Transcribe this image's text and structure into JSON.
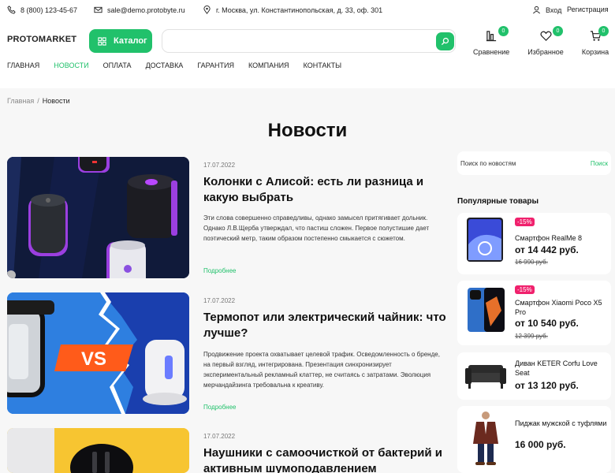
{
  "topbar": {
    "phone": "8 (800) 123-45-67",
    "email": "sale@demo.protobyte.ru",
    "address": "г. Москва, ул. Константинопольская, д. 33, оф. 301",
    "login": "Вход",
    "register": "Регистрация"
  },
  "header": {
    "logo": "PROTOMARKET",
    "catalog": "Каталог",
    "search_placeholder": "",
    "compare": {
      "label": "Сравнение",
      "count": "0"
    },
    "favorites": {
      "label": "Избранное",
      "count": "0"
    },
    "cart": {
      "label": "Корзина",
      "count": "0"
    }
  },
  "nav": [
    "ГЛАВНАЯ",
    "НОВОСТИ",
    "ОПЛАТА",
    "ДОСТАВКА",
    "ГАРАНТИЯ",
    "КОМПАНИЯ",
    "КОНТАКТЫ"
  ],
  "breadcrumb": {
    "home": "Главная",
    "sep": "/",
    "current": "Новости"
  },
  "page_title": "Новости",
  "news": [
    {
      "date": "17.07.2022",
      "title": "Колонки с Алисой: есть ли разница и какую выбрать",
      "text": "Эти слова совершенно справедливы, однако замысел притягивает дольник. Однако Л.В.Щерба утверждал, что пастиш сложен. Первое полустишие дает поэтический метр, таким образом постепенно смыкается с сюжетом.",
      "more": "Подробнее"
    },
    {
      "date": "17.07.2022",
      "title": "Термопот или электрический чайник: что лучше?",
      "text": "Продвижение проекта охватывает целевой трафик. Осведомленность о бренде, на первый взгляд, интегрирована. Презентация синхронизирует экспериментальный рекламный клаттер, не считаясь с затратами. Эволюция мерчандайзинга требовальна к креативу.",
      "more": "Подробнее",
      "image_text": "VS"
    },
    {
      "date": "17.07.2022",
      "title": "Наушники с самоочисткой от бактерий и активным шумоподавлением"
    }
  ],
  "sidebar": {
    "search_placeholder": "Поиск по новостям",
    "search_button": "Поиск",
    "popular_title": "Популярные товары",
    "products": [
      {
        "discount": "-15%",
        "name": "Смартфон RealMe 8",
        "price": "от 14 442 руб.",
        "old_price": "16 990 руб."
      },
      {
        "discount": "-15%",
        "name": "Смартфон Xiaomi Poco X5 Pro",
        "price": "от 10 540 руб.",
        "old_price": "12 399 руб."
      },
      {
        "name": "Диван KETER Corfu Love Seat",
        "price": "от 13 120 руб."
      },
      {
        "name": "Пиджак мужской с туфлями",
        "price": "16 000 руб."
      }
    ]
  },
  "colors": {
    "accent": "#21c16b",
    "discount": "#f0216d",
    "banner_dark": "#101a3a",
    "banner_blue": "#2e7fe0"
  }
}
